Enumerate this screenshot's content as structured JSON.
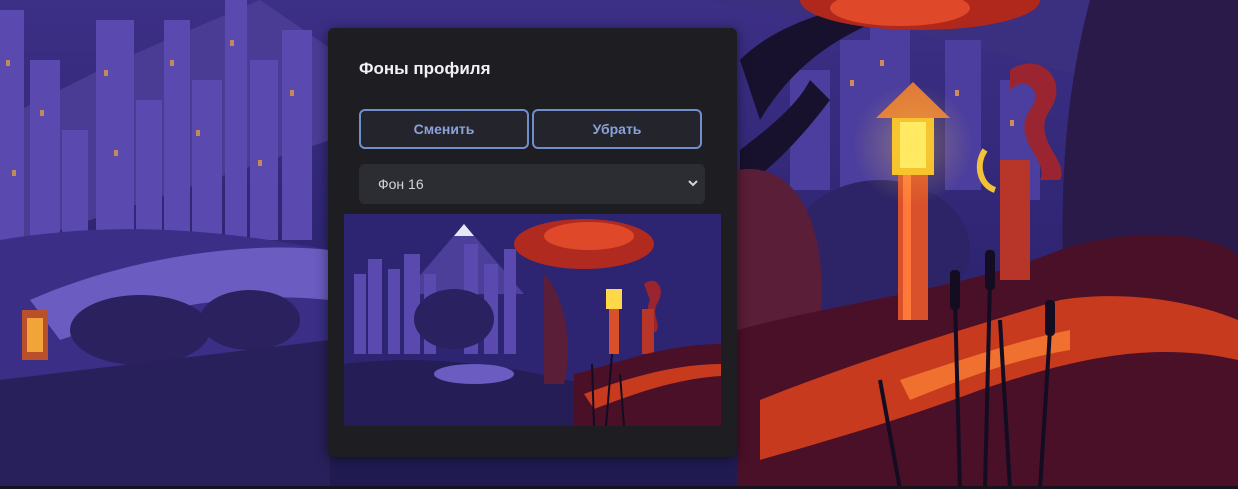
{
  "dialog": {
    "title": "Фоны профиля",
    "change_label": "Сменить",
    "remove_label": "Убрать",
    "background_select": {
      "value": "Фон 16"
    }
  },
  "theme": {
    "panel_bg": "#1e1e22",
    "button_border": "#6e8fc9",
    "button_text": "#8aa2d8",
    "select_bg": "#2c2d33"
  },
  "icons": {
    "select_arrow": "chevron-down-icon"
  }
}
